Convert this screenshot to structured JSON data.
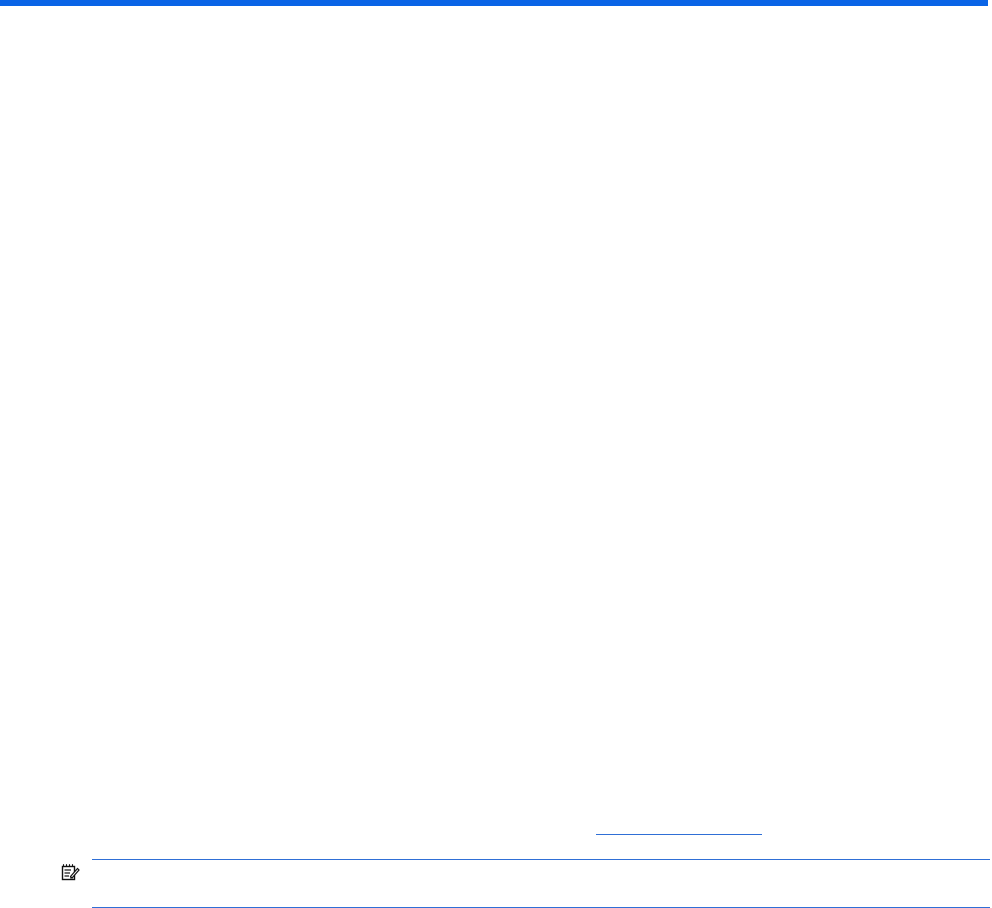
{
  "document": {
    "accent_color": "#0a64e6",
    "rule_color": "#2f6fd6"
  },
  "note": {
    "icon": "note-icon"
  }
}
